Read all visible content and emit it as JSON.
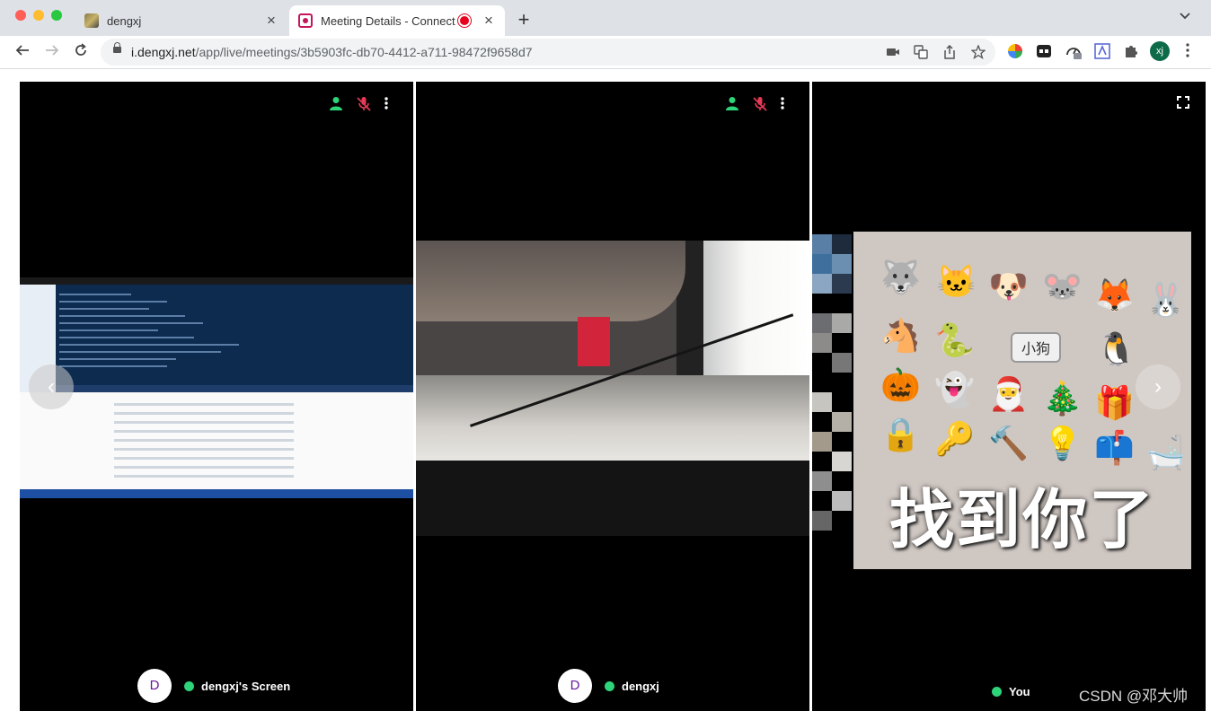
{
  "browser": {
    "tabs": [
      {
        "title": "dengxj",
        "close": "×"
      },
      {
        "title": "Meeting Details - Connect",
        "close": "×"
      }
    ],
    "new_tab": "+",
    "url_host": "i.dengxj.net",
    "url_path": "/app/live/meetings/3b5903fc-db70-4412-a711-98472f9658d7",
    "profile_initials": "xj",
    "accent": "#c2185b"
  },
  "meeting": {
    "tiles": [
      {
        "avatar": "D",
        "name": "dengxj's Screen",
        "status_color": "#2ed47a"
      },
      {
        "avatar": "D",
        "name": "dengxj",
        "status_color": "#2ed47a"
      },
      {
        "name": "You",
        "sticker_caption": "找到你了",
        "sticker_label": "小狗",
        "status_color": "#2ed47a"
      }
    ],
    "icons": [
      "person-icon",
      "mic-off-icon",
      "more-vert-icon",
      "fullscreen-icon"
    ]
  },
  "watermark": "CSDN @邓大帅"
}
